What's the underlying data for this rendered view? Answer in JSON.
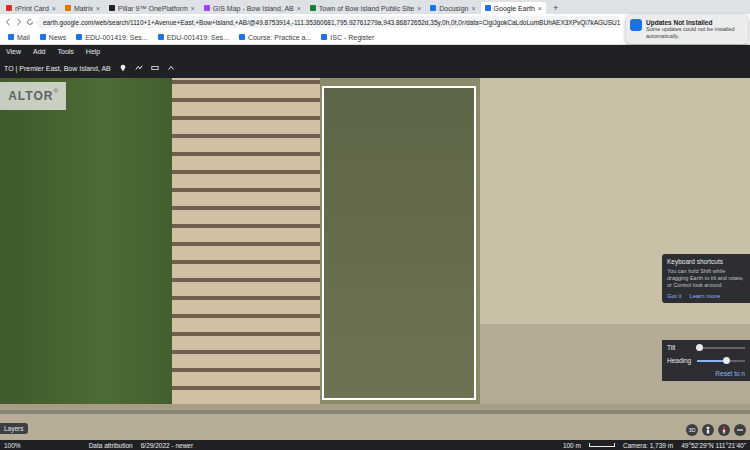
{
  "browser": {
    "tabs": [
      {
        "label": "rPrint Card",
        "selected": false
      },
      {
        "label": "Matrix",
        "selected": false
      },
      {
        "label": "Pillar 9™ OnePlatform",
        "selected": false
      },
      {
        "label": "GIS Map - Bow Island, AB",
        "selected": false
      },
      {
        "label": "Town of Bow Island Public Site",
        "selected": false
      },
      {
        "label": "Docusign",
        "selected": false
      },
      {
        "label": "Google Earth",
        "selected": true
      }
    ],
    "new_tab": "+",
    "close": "×",
    "url": "earth.google.com/web/search/1110+1+Avenue+East,+Bow+Island,+AB/@49.8753914,-111.35360681,795.92761279a,943.86872652d,35y,0h,0t,0r/data=CigiJgokCaLdoLumBUhAEX3XPvQi7kAGUSU1",
    "bookmarks": [
      "Mail",
      "News",
      "EDU-001419: Ses...",
      "EDU-001419: Ses...",
      "Course: Practice a...",
      "ISC - Register"
    ]
  },
  "notification": {
    "title": "Updates Not Installed",
    "body": "Some updates could not be installed automatically."
  },
  "menu": [
    "View",
    "Add",
    "Tools",
    "Help"
  ],
  "search": {
    "value": "TO | Premier East, Bow Island, AB"
  },
  "watermark": {
    "text": "ALTOR",
    "mark": "®"
  },
  "shortcuts": {
    "title": "Keyboard shortcuts",
    "body": "You can hold Shift while dragging Earth to tilt and rotate, or Control look around.",
    "buttons": [
      "Got it",
      "Learn more"
    ]
  },
  "sliders": [
    {
      "label": "Tilt",
      "level": 0.05
    },
    {
      "label": "Heading",
      "level": 0.6
    }
  ],
  "reset": "Reset to n",
  "layers": "Layers",
  "view_button": "3D",
  "status": {
    "zoom": "100%",
    "attribution": "Data attribution",
    "date": "6/29/2022 - newer",
    "scale": "100 m",
    "camera": "Camera: 1,739 m",
    "coords": "49°52'29\"N 111°21'40\""
  }
}
